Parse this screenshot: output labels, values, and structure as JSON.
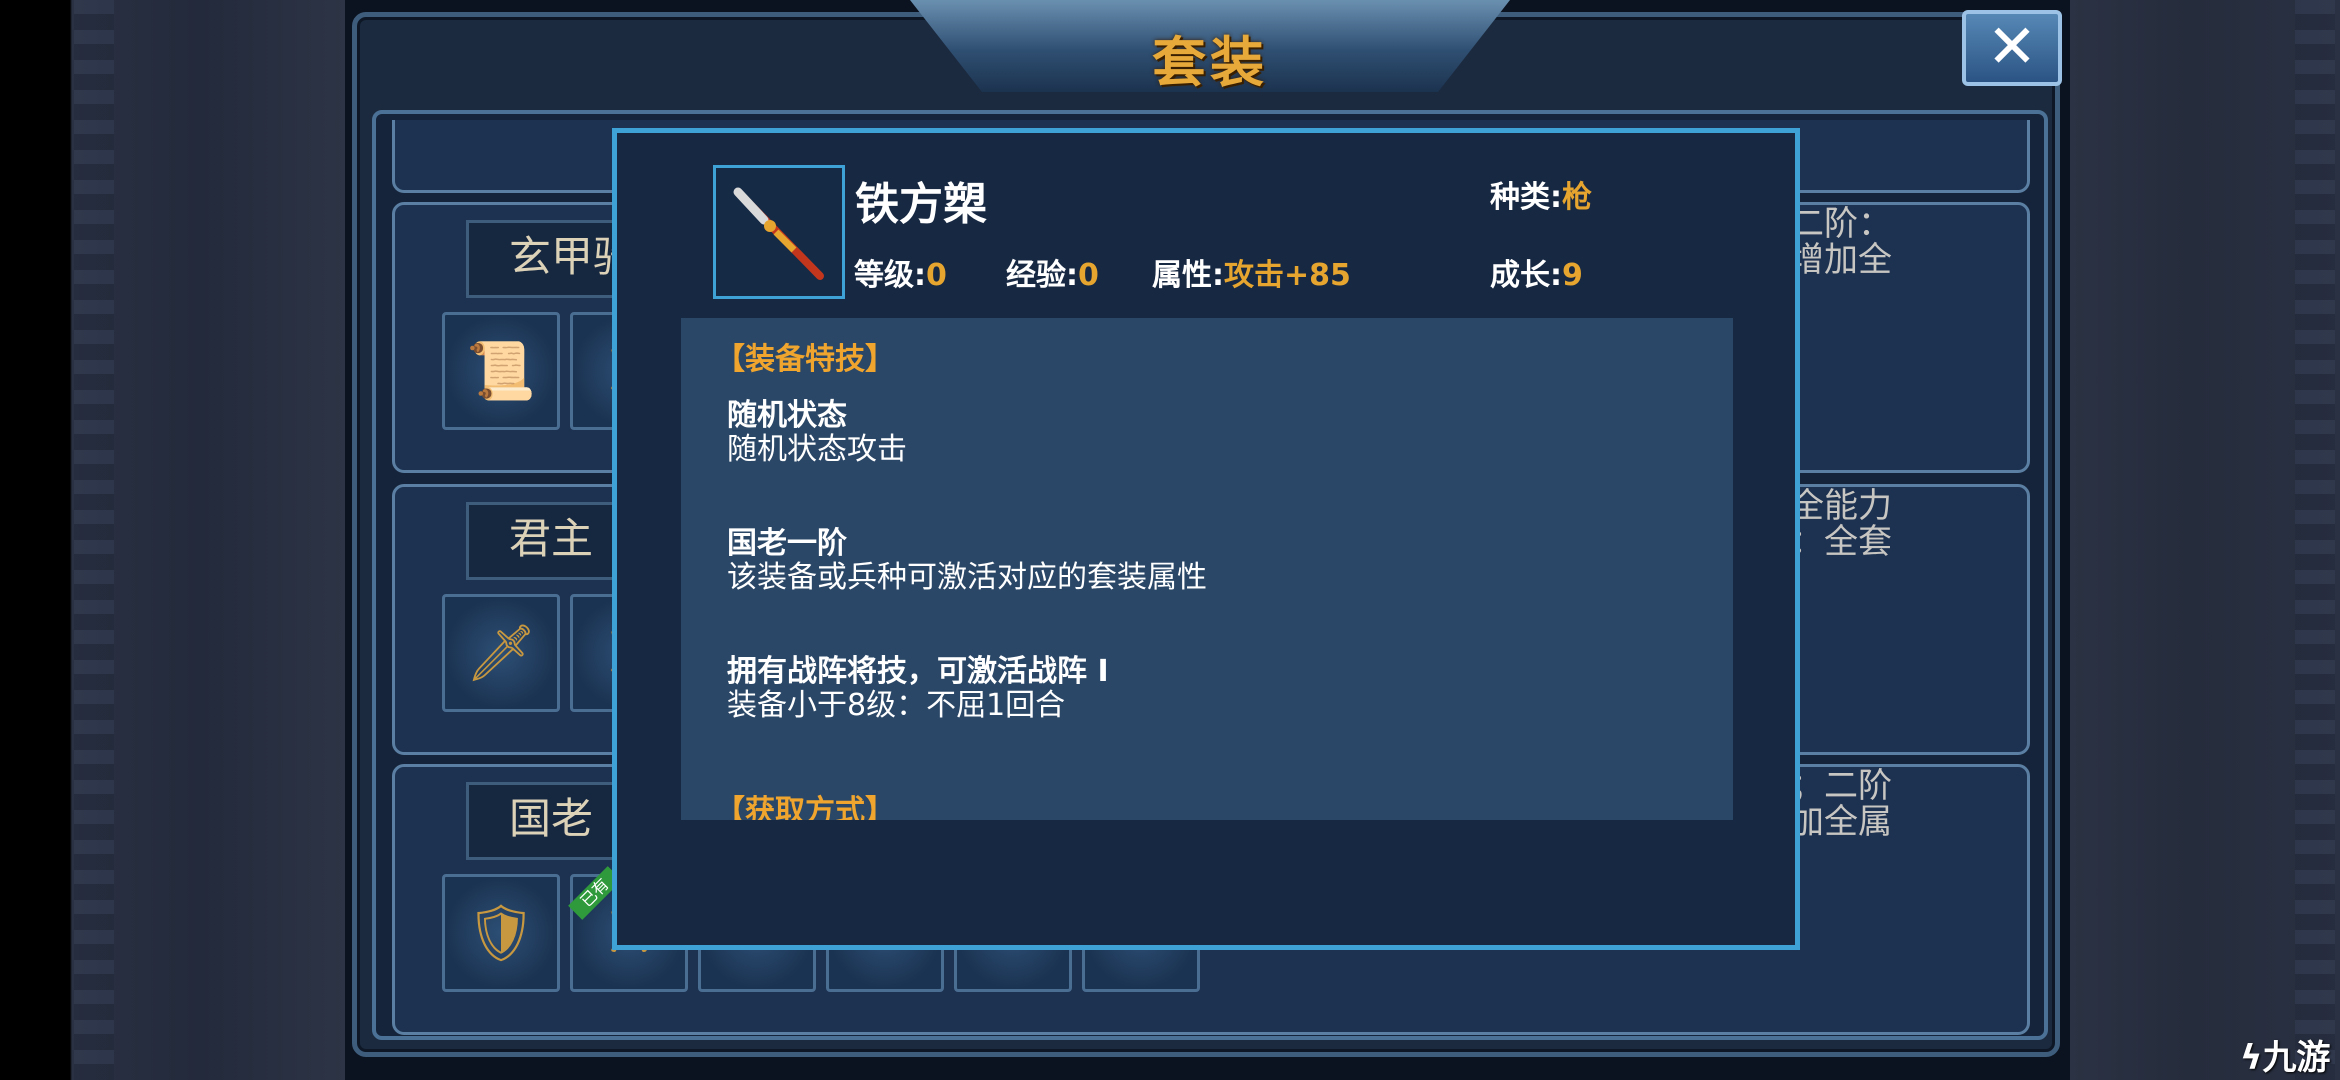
{
  "header": {
    "title": "套装",
    "close_symbol": "✕"
  },
  "background_sets": [
    {
      "name": "玄甲骑",
      "right_line1": "二阶：",
      "right_line2": "增加全"
    },
    {
      "name": "君主",
      "right_line1": "全能力",
      "right_line2": "：全套"
    },
    {
      "name": "国老",
      "right_line1": "；二阶",
      "right_line2": "加全属"
    }
  ],
  "owned_badge": "已有",
  "item": {
    "name": "铁方槊",
    "level_label": "等级:",
    "level_value": "0",
    "exp_label": "经验:",
    "exp_value": "0",
    "attr_label": "属性:",
    "attr_value": "攻击+85",
    "type_label": "种类:",
    "type_value": "枪",
    "growth_label": "成长:",
    "growth_value": "9",
    "icon": "spear-icon"
  },
  "description": {
    "skills_header": "【装备特技】",
    "skills": [
      {
        "title": "随机状态",
        "desc": "随机状态攻击"
      },
      {
        "title": "国老一阶",
        "desc": "该装备或兵种可激活对应的套装属性"
      },
      {
        "title": "拥有战阵将技，可激活战阵 I",
        "desc": "装备小于8级：不屈1回合"
      }
    ],
    "obtain_header": "【获取方式】"
  },
  "watermark": "九游",
  "colors": {
    "accent_gold": "#e6a52f",
    "modal_border": "#3ea2d6",
    "modal_bg": "#172842",
    "desc_bg": "#2a4767"
  }
}
